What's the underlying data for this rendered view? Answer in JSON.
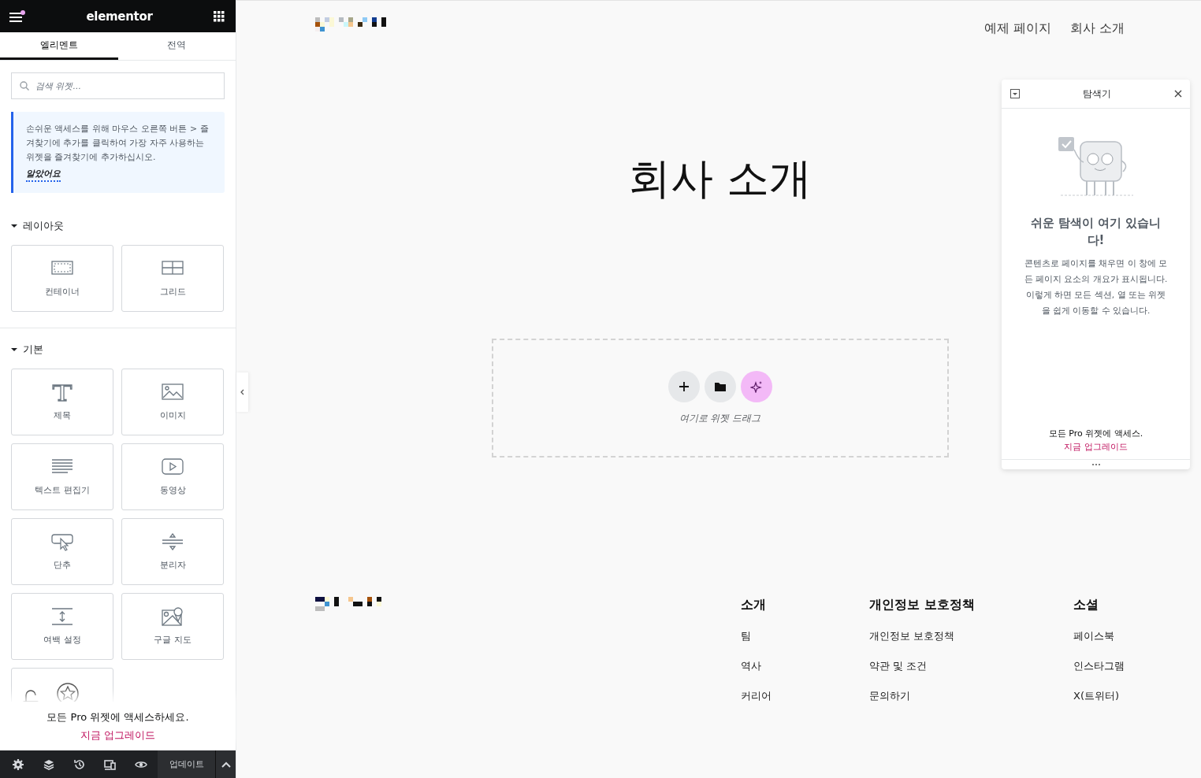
{
  "editor_panel": {
    "brand": "elementor",
    "tabs": [
      {
        "label": "엘리멘트",
        "selected": true
      },
      {
        "label": "전역",
        "selected": false
      }
    ],
    "search": {
      "placeholder": "검색 위젯..."
    },
    "notice": {
      "text": "손쉬운 액세스를 위해 마우스 오른쪽 버튼 > 즐겨찾기에 추가를 클릭하여 가장 자주 사용하는 위젯을 즐겨찾기에 추가하십시오.",
      "link": "알았어요"
    },
    "categories": [
      {
        "title": "레이아웃",
        "expanded": true,
        "widgets": [
          {
            "kind": "widget",
            "label": "컨테이너"
          },
          {
            "kind": "widget",
            "label": "그리드"
          }
        ]
      },
      {
        "title": "기본",
        "expanded": true,
        "widgets": [
          {
            "kind": "widget",
            "label": "제목"
          },
          {
            "kind": "widget",
            "label": "이미지"
          },
          {
            "kind": "widget",
            "label": "텍스트 편집기"
          },
          {
            "kind": "widget",
            "label": "동영상"
          },
          {
            "kind": "widget",
            "label": "단추"
          },
          {
            "kind": "widget",
            "label": "분리자"
          },
          {
            "kind": "widget",
            "label": "여백 설정"
          },
          {
            "kind": "widget",
            "label": "구글 지도"
          },
          {
            "kind": "promo"
          }
        ]
      }
    ],
    "promo": {
      "text": "모든 Pro 위젯에 액세스하세요.",
      "link": "지금 업그레이드"
    },
    "update_button": "업데이트"
  },
  "canvas": {
    "nav": [
      "예제 페이지",
      "회사 소개"
    ],
    "page_title": "회사 소개",
    "drop_zone": {
      "hint": "여기로 위젯 드래그"
    },
    "footer_columns": [
      {
        "heading": "소개",
        "links": [
          "팀",
          "역사",
          "커리어"
        ]
      },
      {
        "heading": "개인정보 보호정책",
        "links": [
          "개인정보 보호정책",
          "약관 및 조건",
          "문의하기"
        ]
      },
      {
        "heading": "소셜",
        "links": [
          "페이스북",
          "인스타그램",
          "X(트위터)"
        ]
      }
    ]
  },
  "navigator": {
    "title": "탐색기",
    "heading": "쉬운 탐색이 여기 있습니다!",
    "body": "콘텐츠로 페이지를 채우면 이 창에 모든 페이지 요소의 개요가 표시됩니다. 이렇게 하면 모든 섹션, 열 또는 위젯을 쉽게 이동할 수 있습니다.",
    "promo_text": "모든 Pro 위젯에 액세스. ",
    "promo_link": "지금 업그레이드"
  }
}
